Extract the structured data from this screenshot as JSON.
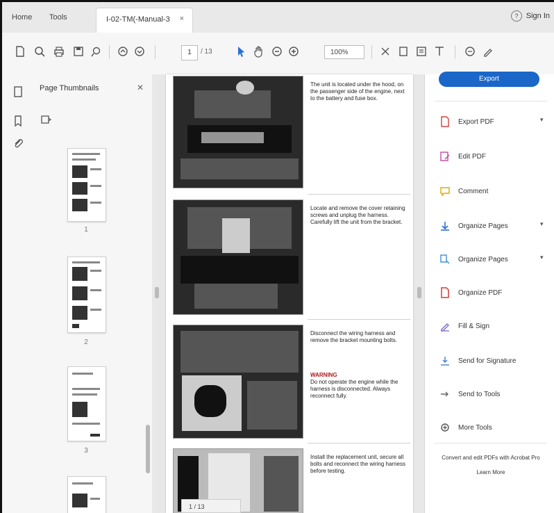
{
  "menu": {
    "home": "Home",
    "tools": "Tools"
  },
  "tab": {
    "title": "I-02-TM(-Manual-3",
    "close": "×"
  },
  "header": {
    "help": "?",
    "signin": "Sign In"
  },
  "toolbar": {
    "page_current": "1",
    "page_total": "/ 13",
    "zoom": "100%"
  },
  "thumbnails": {
    "title": "Page Thumbnails",
    "close_icon": "close-icon",
    "page_labels": [
      "1",
      "2",
      "3"
    ]
  },
  "document": {
    "sections": [
      {
        "text": "The unit is located under the hood, on the passenger side of the engine, next to the battery and fuse box."
      },
      {
        "text": "Locate and remove the cover retaining screws and unplug the harness. Carefully lift the unit from the bracket."
      },
      {
        "text": "Disconnect the wiring harness and remove the bracket mounting bolts.",
        "warning_title": "WARNING",
        "warning_text": "Do not operate the engine while the harness is disconnected. Always reconnect fully."
      },
      {
        "text": "Install the replacement unit, secure all bolts and reconnect the wiring harness before testing."
      }
    ],
    "page_control": "1 / 13"
  },
  "tools": {
    "cta_label": "Export",
    "items": [
      {
        "label": "Export PDF",
        "icon": "export-pdf-icon",
        "chevron": "▾"
      },
      {
        "label": "Edit PDF",
        "icon": "edit-pdf-icon"
      },
      {
        "label": "Comment",
        "icon": "comment-icon"
      },
      {
        "label": "Organize Pages",
        "icon": "organize-pages-icon",
        "chevron": "▾"
      },
      {
        "label": "Organize Pages",
        "icon": "organize-pages-alt-icon",
        "chevron": "▾"
      },
      {
        "label": "Organize PDF",
        "icon": "organize-pdf-icon"
      },
      {
        "label": "Fill & Sign",
        "icon": "fill-sign-icon"
      },
      {
        "label": "Send for Signature",
        "icon": "send-signature-icon"
      },
      {
        "label": "Send to Tools",
        "icon": "send-tools-icon"
      },
      {
        "label": "More Tools",
        "icon": "more-tools-icon"
      }
    ],
    "promo_text": "Convert and edit PDFs with Acrobat Pro",
    "promo_link": "Learn More"
  },
  "colors": {
    "accent": "#1a66c9",
    "warning": "#b01818"
  }
}
